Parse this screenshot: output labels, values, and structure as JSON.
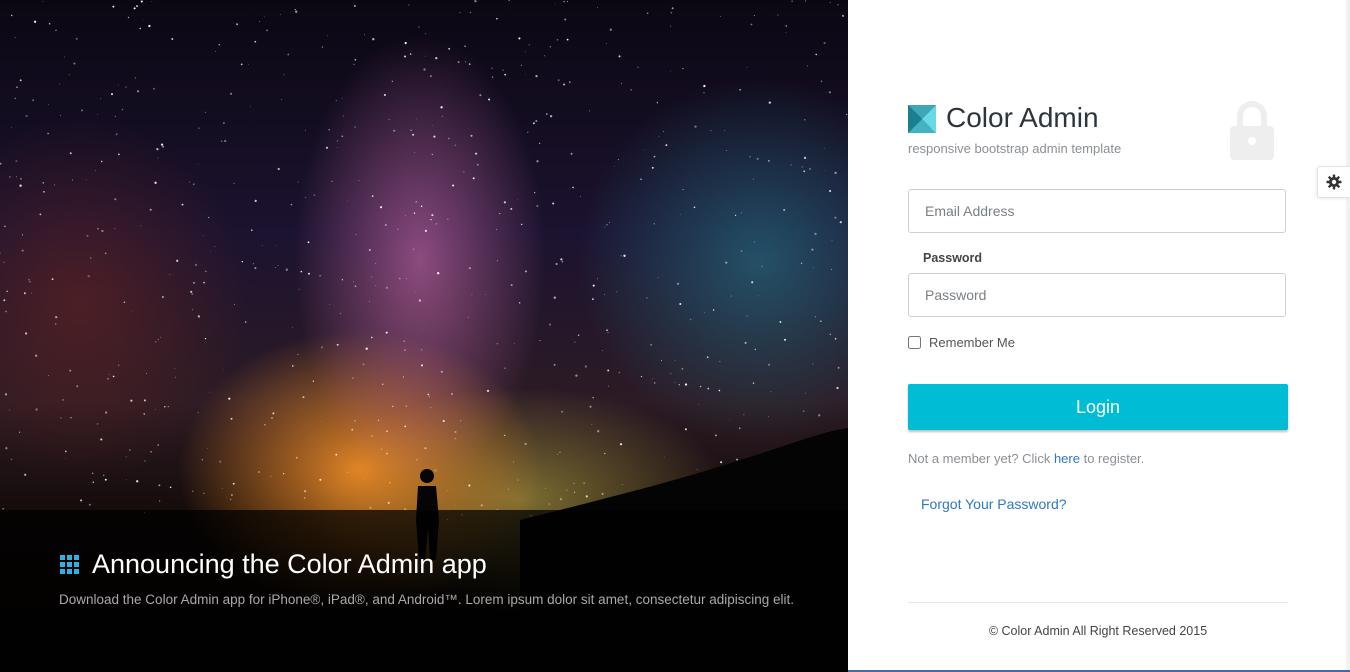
{
  "news": {
    "title": "Announcing the Color Admin app",
    "text": "Download the Color Admin app for iPhone®, iPad®, and Android™. Lorem ipsum dolor sit amet, consectetur adipiscing elit.",
    "icon": "apps-grid-icon"
  },
  "brand": {
    "name": "Color Admin",
    "subtitle": "responsive bootstrap admin template",
    "logo_icon": "color-admin-logo-icon",
    "lock_icon": "lock-icon"
  },
  "login": {
    "email_placeholder": "Email Address",
    "password_label": "Password",
    "password_placeholder": "Password",
    "remember_label": "Remember Me",
    "button_label": "Login",
    "register_prefix": "Not a member yet? Click ",
    "register_link": "here",
    "register_suffix": " to register.",
    "forgot_label": "Forgot Your Password?"
  },
  "footer": {
    "copyright": "© Color Admin All Right Reserved 2015"
  },
  "settings": {
    "icon": "gear-icon"
  },
  "colors": {
    "accent": "#00bcd4",
    "link": "#2f78c4",
    "apps_icon": "#2ab3e4"
  }
}
